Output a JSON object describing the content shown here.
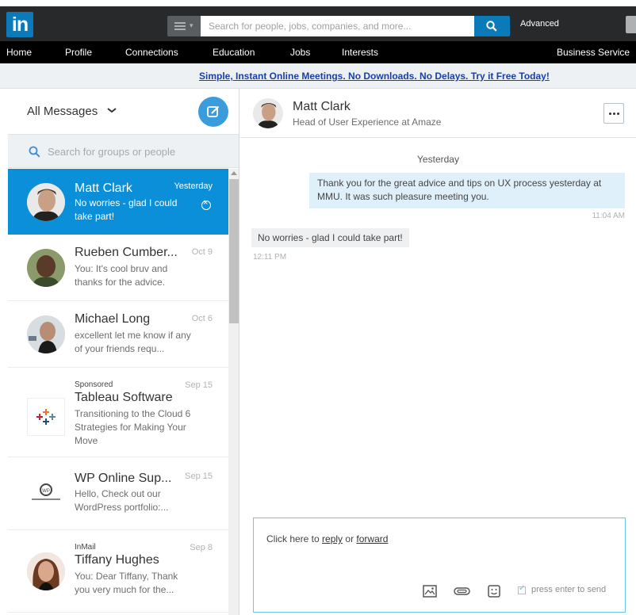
{
  "topbar": {
    "logo_text": "in",
    "search_placeholder": "Search for people, jobs, companies, and more...",
    "advanced_label": "Advanced"
  },
  "nav": {
    "items": [
      "Home",
      "Profile",
      "Connections",
      "Education",
      "Jobs",
      "Interests",
      "Business Service"
    ]
  },
  "ad": {
    "text": "Simple, Instant Online Meetings. No Downloads. No Delays. Try it Free Today!"
  },
  "inbox": {
    "title": "All Messages",
    "search_placeholder": "Search for groups or people",
    "threads": [
      {
        "name": "Matt Clark",
        "date": "Yesterday",
        "preview": "No worries - glad I could take part!",
        "sub": "",
        "active": true
      },
      {
        "name": "Rueben Cumber...",
        "date": "Oct 9",
        "preview": "You: It's cool bruv and thanks for the advice.",
        "sub": ""
      },
      {
        "name": "Michael Long",
        "date": "Oct 6",
        "preview": "excellent let me know if any of your friends requ...",
        "sub": ""
      },
      {
        "name": "Tableau Software",
        "date": "Sep 15",
        "preview": "Transitioning to the Cloud 6 Strategies for Making Your Move",
        "sub": "Sponsored"
      },
      {
        "name": "WP Online Sup...",
        "date": "Sep 15",
        "preview": "Hello, Check out our WordPress portfolio:...",
        "sub": ""
      },
      {
        "name": "Tiffany Hughes",
        "date": "Sep 8",
        "preview": "You: Dear Tiffany, Thank you very much for the...",
        "sub": "InMail"
      }
    ]
  },
  "conversation": {
    "name": "Matt Clark",
    "headline": "Head of User Experience at Amaze",
    "day_label": "Yesterday",
    "messages": [
      {
        "text": "Thank you for the great advice and tips on UX process yesterday at MMU. It was such pleasure meeting you.",
        "time": "11:04 AM",
        "direction": "out"
      },
      {
        "text": "No worries - glad I could take part!",
        "time": "12:11 PM",
        "direction": "in"
      }
    ]
  },
  "composer": {
    "prefix": "Click here to",
    "reply": "reply",
    "or": "or",
    "forward": "forward",
    "enter_label": "press enter to send"
  },
  "colors": {
    "linkedin_blue": "#0a7ab9",
    "active_thread": "#0b8fd8",
    "outgoing_bubble": "#dff0fb"
  }
}
